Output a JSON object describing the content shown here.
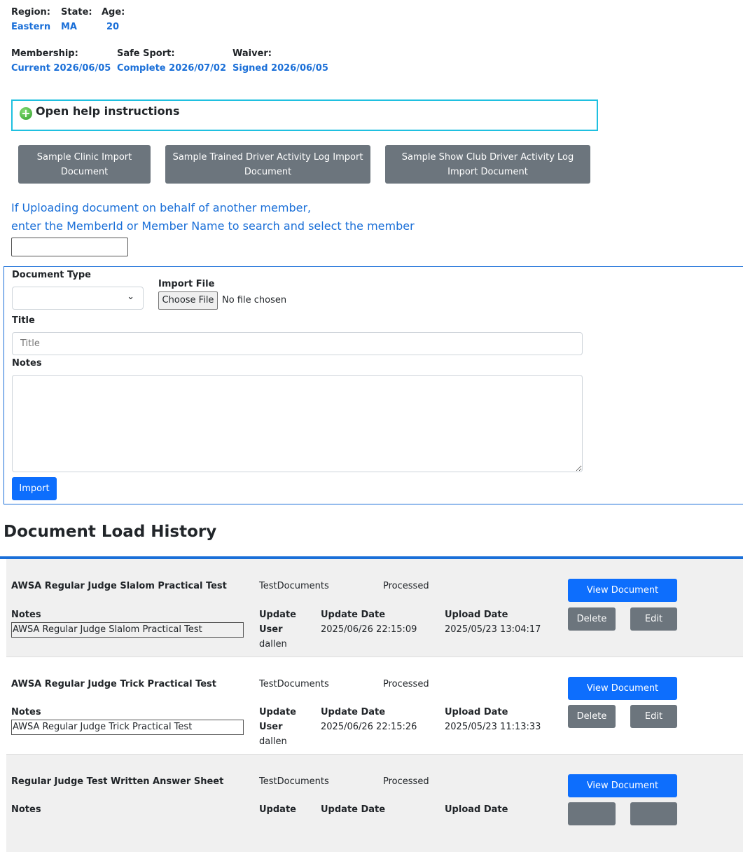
{
  "member": {
    "region_label": "Region:",
    "region": "Eastern",
    "state_label": "State:",
    "state": "MA",
    "age_label": "Age:",
    "age": "20",
    "membership_label": "Membership:",
    "membership": "Current 2026/06/05",
    "safesport_label": "Safe Sport:",
    "safesport": "Complete 2026/07/02",
    "waiver_label": "Waiver:",
    "waiver": "Signed 2026/06/05"
  },
  "help": {
    "label": "Open help instructions",
    "icon": "plus-circle-icon"
  },
  "samples": [
    "Sample Clinic Import Document",
    "Sample Trained Driver Activity Log Import Document",
    "Sample Show Club Driver Activity Log Import Document"
  ],
  "behalf": {
    "line1": "If Uploading document on behalf of another member,",
    "line2": "enter the MemberId or Member Name to search and select the member",
    "value": ""
  },
  "form": {
    "doc_type_label": "Document Type",
    "doc_type_value": "",
    "import_file_label": "Import File",
    "choose_file": "Choose File",
    "no_file": "No file chosen",
    "title_label": "Title",
    "title_placeholder": "Title",
    "notes_label": "Notes",
    "import_button": "Import"
  },
  "history": {
    "heading": "Document Load History",
    "labels": {
      "notes": "Notes",
      "update": "Update",
      "user": "User",
      "update_date": "Update Date",
      "upload_date": "Upload Date",
      "view": "View Document",
      "delete": "Delete",
      "edit": "Edit"
    },
    "rows": [
      {
        "title": "AWSA Regular Judge Slalom Practical Test",
        "category": "TestDocuments",
        "status": "Processed",
        "notes": "AWSA Regular Judge Slalom Practical Test",
        "user": "dallen",
        "update_date": "2025/06/26 22:15:09",
        "upload_date": "2025/05/23 13:04:17"
      },
      {
        "title": "AWSA Regular Judge Trick Practical Test",
        "category": "TestDocuments",
        "status": "Processed",
        "notes": "AWSA Regular Judge Trick Practical Test",
        "user": "dallen",
        "update_date": "2025/06/26 22:15:26",
        "upload_date": "2025/05/23 11:13:33"
      },
      {
        "title": "Regular Judge Test Written Answer Sheet",
        "category": "TestDocuments",
        "status": "Processed"
      }
    ]
  }
}
